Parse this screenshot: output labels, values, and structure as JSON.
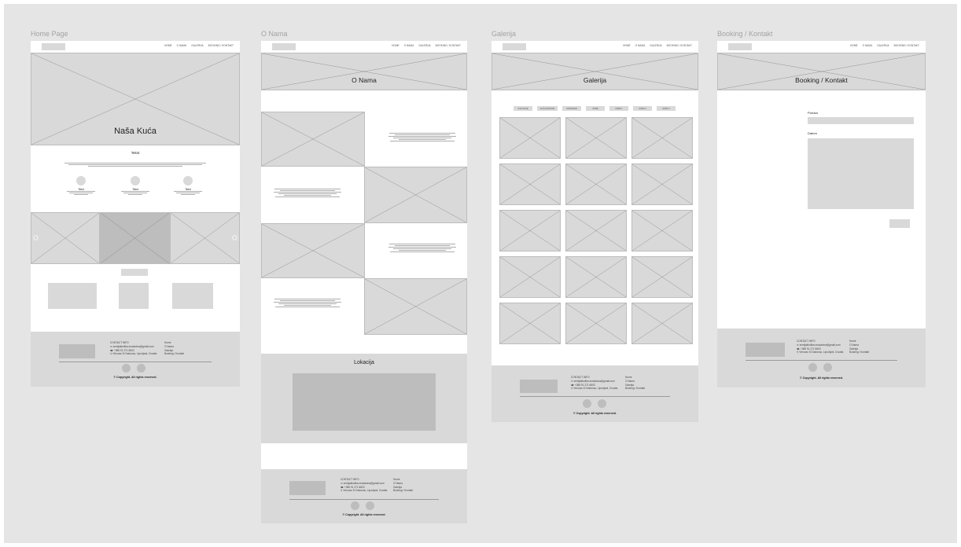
{
  "frames": {
    "home": "Home Page",
    "about": "O Nama",
    "gallery": "Galerija",
    "booking": "Booking / Kontakt"
  },
  "nav": [
    "HOME",
    "O NAMA",
    "GALERIJA",
    "BOOKING / KONTAKT"
  ],
  "home": {
    "hero_title": "Naša Kuća",
    "section_title": "Tekst",
    "features": [
      "Tekst",
      "Tekst",
      "Tekst"
    ]
  },
  "about": {
    "hero_title": "O Nama",
    "location_title": "Lokacija"
  },
  "gallery": {
    "hero_title": "Galerija",
    "filters": [
      "SVE SLIKE",
      "KUĆA/VANJSKI",
      "INTERIJER",
      "SOBE",
      "SOBA 1",
      "SOBA 2",
      "SOBA 3"
    ]
  },
  "booking": {
    "hero_title": "Booking / Kontakt",
    "field_1": "Poruka",
    "field_2": "Datum"
  },
  "footer": {
    "contact_heading": "CONTACT INFO",
    "email": "zemljakkoliba.moslavina@gmail.com",
    "phone": "+385 91 271 8603",
    "address": "Vrhovac 8 Grabovac, Lipovljani, Croatia",
    "links": [
      "Home",
      "O Nama",
      "Galerija",
      "Booking / Kontakt"
    ],
    "copyright": "© Copyright. All rights reserved."
  },
  "icons": [
    "envelope-icon",
    "phone-icon",
    "location-pin-icon",
    "chevron-left-icon",
    "chevron-right-icon"
  ]
}
